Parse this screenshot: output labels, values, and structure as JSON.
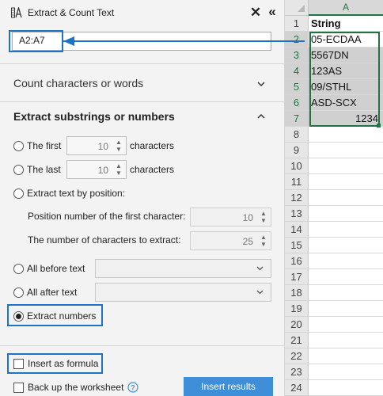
{
  "pane": {
    "title": "Extract & Count Text",
    "close_label": "✕",
    "collapse_label": "«",
    "range_value": "A2:A7",
    "count_section_title": "Count characters or words",
    "extract_section_title": "Extract substrings or numbers",
    "first_label": "The first",
    "first_value": "10",
    "first_unit": "characters",
    "last_label": "The last",
    "last_value": "10",
    "last_unit": "characters",
    "by_position_label": "Extract text by position:",
    "position_first_label": "Position number of the first character:",
    "position_first_value": "10",
    "num_chars_label": "The number of characters to extract:",
    "num_chars_value": "25",
    "all_before_label": "All before text",
    "all_after_label": "All after text",
    "extract_numbers_label": "Extract numbers",
    "insert_formula_label": "Insert as formula",
    "backup_label": "Back up the worksheet",
    "insert_button_label": "Insert results",
    "selected_option": "extract_numbers"
  },
  "sheet": {
    "column_header": "A",
    "rows": [
      {
        "num": "1",
        "value": "String"
      },
      {
        "num": "2",
        "value": "05-ECDAA"
      },
      {
        "num": "3",
        "value": "5567DN"
      },
      {
        "num": "4",
        "value": "123AS"
      },
      {
        "num": "5",
        "value": "09/STHL"
      },
      {
        "num": "6",
        "value": "ASD-SCX"
      },
      {
        "num": "7",
        "value": "1234"
      },
      {
        "num": "8",
        "value": ""
      },
      {
        "num": "9",
        "value": ""
      },
      {
        "num": "10",
        "value": ""
      },
      {
        "num": "11",
        "value": ""
      },
      {
        "num": "12",
        "value": ""
      },
      {
        "num": "13",
        "value": ""
      },
      {
        "num": "14",
        "value": ""
      },
      {
        "num": "15",
        "value": ""
      },
      {
        "num": "16",
        "value": ""
      },
      {
        "num": "17",
        "value": ""
      },
      {
        "num": "18",
        "value": ""
      },
      {
        "num": "19",
        "value": ""
      },
      {
        "num": "20",
        "value": ""
      },
      {
        "num": "21",
        "value": ""
      },
      {
        "num": "22",
        "value": ""
      },
      {
        "num": "23",
        "value": ""
      },
      {
        "num": "24",
        "value": ""
      }
    ]
  },
  "colors": {
    "accent_blue": "#1d73c9",
    "excel_green": "#217346",
    "button_blue": "#3f8fd8"
  },
  "icons": [
    "extract-text-icon",
    "close-icon",
    "collapse-icon",
    "chevron-down-icon",
    "chevron-up-icon",
    "help-icon"
  ]
}
